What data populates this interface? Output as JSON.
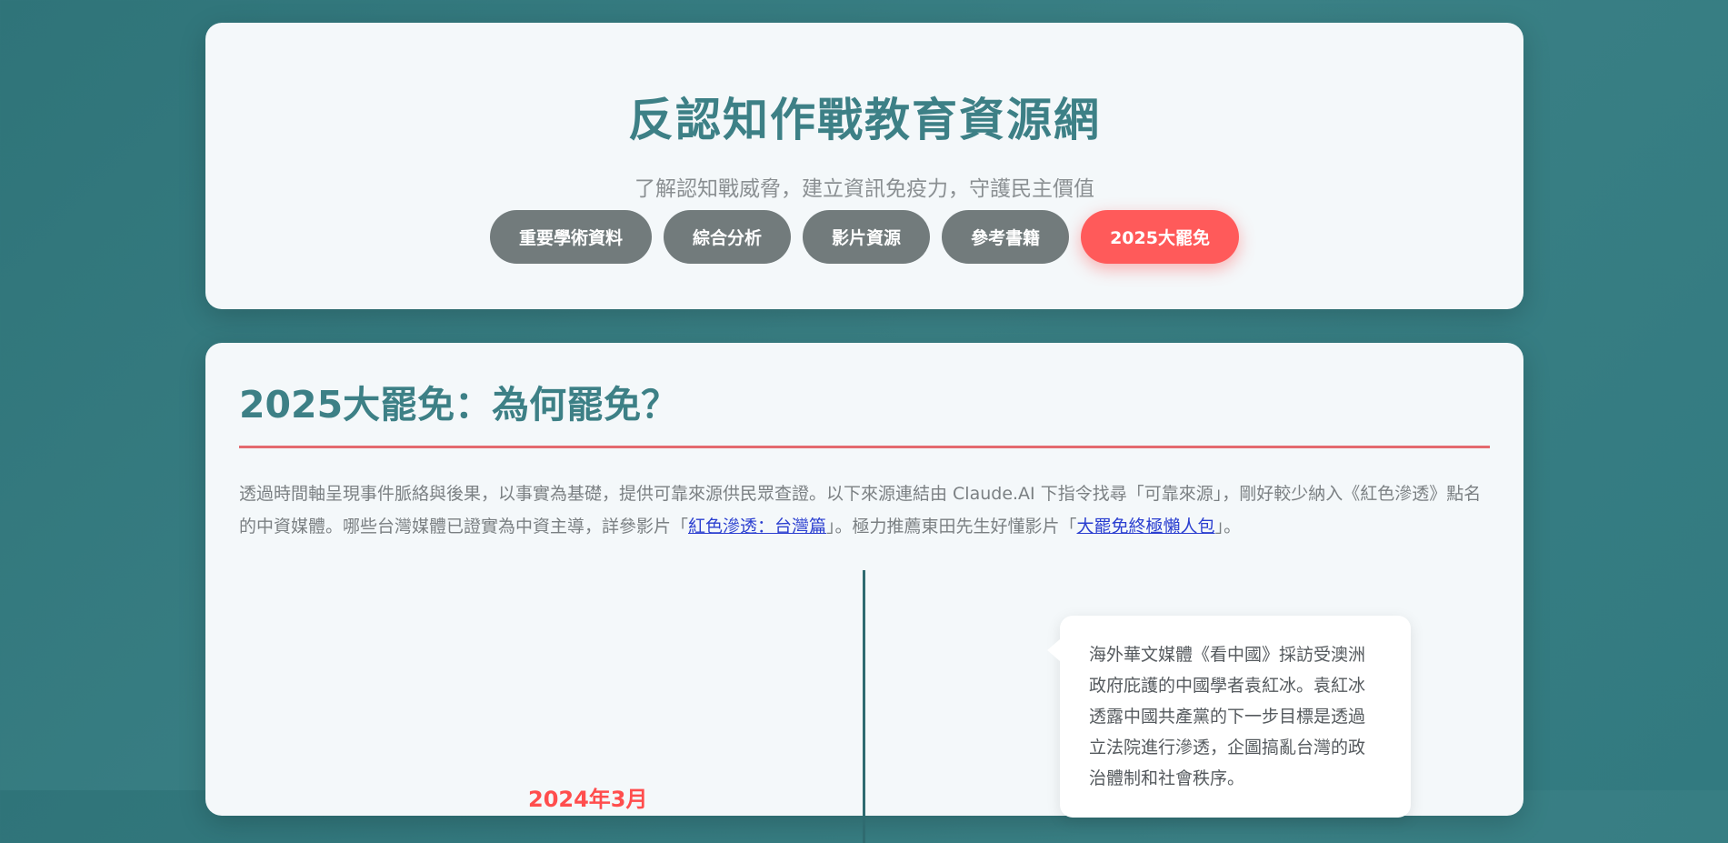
{
  "header": {
    "title": "反認知作戰教育資源網",
    "subtitle": "了解認知戰威脅，建立資訊免疫力，守護民主價值",
    "nav": [
      {
        "label": "重要學術資料",
        "active": false
      },
      {
        "label": "綜合分析",
        "active": false
      },
      {
        "label": "影片資源",
        "active": false
      },
      {
        "label": "參考書籍",
        "active": false
      },
      {
        "label": "2025大罷免",
        "active": true
      }
    ]
  },
  "section": {
    "title": "2025大罷免：為何罷免？",
    "intro_part1": "透過時間軸呈現事件脈絡與後果，以事實為基礎，提供可靠來源供民眾查證。以下來源連結由 Claude.AI 下指令找尋「可靠來源」，剛好較少納入《紅色滲透》點名的中資媒體。哪些台灣媒體已證實為中資主導，詳參影片「",
    "link1": "紅色滲透：台灣篇",
    "intro_part2": "」。極力推薦東田先生好懂影片「",
    "link2": "大罷免終極懶人包",
    "intro_part3": "」。"
  },
  "timeline": {
    "date": "2024年3月",
    "event": "海外華文媒體《看中國》採訪受澳洲政府庇護的中國學者袁紅冰。袁紅冰透露中國共產黨的下一步目標是透過立法院進行滲透，企圖搞亂台灣的政治體制和社會秩序。"
  },
  "colors": {
    "background": "#347a7f",
    "accent_teal": "#3d8086",
    "accent_red": "#ff5a5a",
    "nav_gray": "#727b7c"
  }
}
